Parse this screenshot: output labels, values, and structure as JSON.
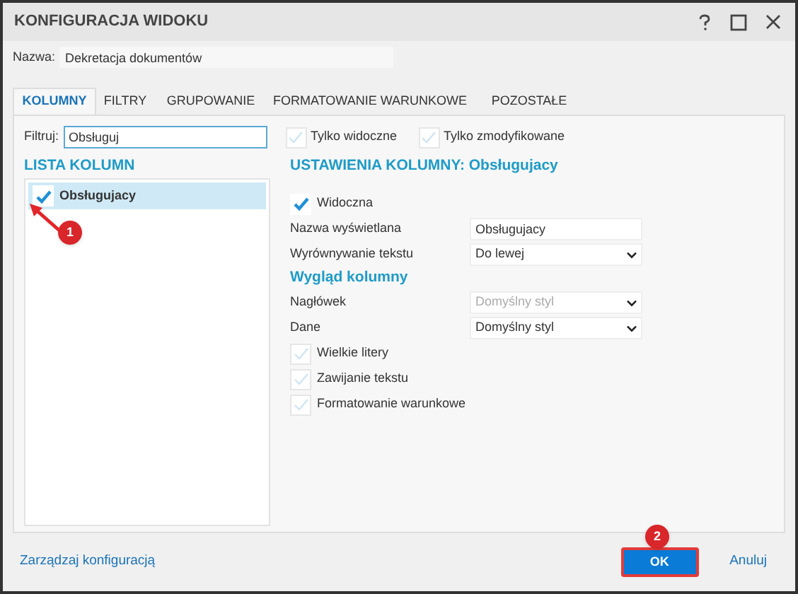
{
  "window": {
    "title": "KONFIGURACJA WIDOKU"
  },
  "name_field": {
    "label": "Nazwa:",
    "value": "Dekretacja dokumentów"
  },
  "tabs": [
    {
      "label": "KOLUMNY",
      "selected": true
    },
    {
      "label": "FILTRY",
      "selected": false
    },
    {
      "label": "GRUPOWANIE",
      "selected": false
    },
    {
      "label": "FORMATOWANIE WARUNKOWE",
      "selected": false
    },
    {
      "label": "POZOSTAŁE",
      "selected": false
    }
  ],
  "filter": {
    "label": "Filtruj:",
    "value": "Obsługuj",
    "options": [
      {
        "label": "Tylko widoczne",
        "checked": false
      },
      {
        "label": "Tylko zmodyfikowane",
        "checked": false
      }
    ]
  },
  "column_list": {
    "title": "LISTA KOLUMN",
    "items": [
      {
        "label": "Obsługujacy",
        "checked": true,
        "selected": true
      }
    ]
  },
  "settings": {
    "title": "USTAWIENIA KOLUMNY: Obsługujacy",
    "rows": [
      {
        "kind": "checkbox",
        "label": "Widoczna",
        "checked": true
      },
      {
        "kind": "text",
        "label": "Nazwa wyświetlana",
        "value": "Obsługujacy"
      },
      {
        "kind": "select",
        "label": "Wyrównywanie tekstu",
        "value": "Do lewej",
        "disabled": false
      },
      {
        "kind": "heading",
        "label": "Wygląd kolumny"
      },
      {
        "kind": "select",
        "label": "Nagłówek",
        "value": "Domyślny styl",
        "disabled": true
      },
      {
        "kind": "select",
        "label": "Dane",
        "value": "Domyślny styl",
        "disabled": false
      },
      {
        "kind": "checkbox",
        "label": "Wielkie litery",
        "checked": false
      },
      {
        "kind": "checkbox",
        "label": "Zawijanie tekstu",
        "checked": false
      },
      {
        "kind": "checkbox",
        "label": "Formatowanie warunkowe",
        "checked": false
      }
    ]
  },
  "footer": {
    "link": "Zarządzaj konfiguracją",
    "buttons": [
      {
        "label": "OK",
        "kind": "primary"
      },
      {
        "label": "Anuluj",
        "kind": "link"
      }
    ]
  },
  "annotations": [
    {
      "label": "1"
    },
    {
      "label": "2"
    }
  ]
}
